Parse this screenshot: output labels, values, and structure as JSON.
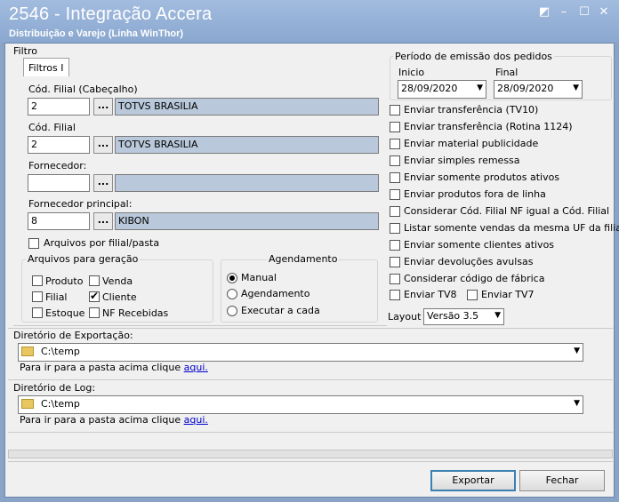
{
  "window": {
    "title": "2546 - Integração Accera",
    "subtitle": "Distribuição e Varejo (Linha WinThor)",
    "buttons": {
      "restore": "◩",
      "minimize": "–",
      "maximize": "☐",
      "close": "✕"
    }
  },
  "filtro": {
    "group_label": "Filtro",
    "tab": "Filtros I",
    "cod_filial_cab": {
      "label": "Cód. Filial (Cabeçalho)",
      "code": "2",
      "name": "TOTVS BRASILIA"
    },
    "cod_filial": {
      "label": "Cód. Filial",
      "code": "2",
      "name": "TOTVS BRASILIA"
    },
    "fornecedor": {
      "label": "Fornecedor:",
      "code": "",
      "name": ""
    },
    "fornecedor_principal": {
      "label": "Fornecedor principal:",
      "code": "8",
      "name": "KIBON"
    },
    "ellipsis": "...",
    "arquivos_por_filial": "Arquivos por filial/pasta"
  },
  "arquivos_geracao": {
    "label": "Arquivos para geração",
    "items": [
      {
        "label": "Produto",
        "checked": false
      },
      {
        "label": "Venda",
        "checked": false
      },
      {
        "label": "Filial",
        "checked": false
      },
      {
        "label": "Cliente",
        "checked": true
      },
      {
        "label": "Estoque",
        "checked": false
      },
      {
        "label": "NF Recebidas",
        "checked": false
      }
    ]
  },
  "agendamento": {
    "label": "Agendamento",
    "options": [
      {
        "label": "Manual",
        "selected": true
      },
      {
        "label": "Agendamento",
        "selected": false
      },
      {
        "label": "Executar a cada",
        "selected": false
      }
    ]
  },
  "periodo": {
    "label": "Período de emissão dos pedidos",
    "inicio_label": "Inicio",
    "inicio": "28/09/2020",
    "final_label": "Final",
    "final": "28/09/2020"
  },
  "options": [
    "Enviar transferência (TV10)",
    "Enviar transferência (Rotina 1124)",
    "Enviar material publicidade",
    "Enviar simples remessa",
    "Enviar somente produtos ativos",
    "Enviar produtos fora de linha",
    "Considerar Cód. Filial NF igual a Cód. Filial",
    "Listar somente vendas da mesma UF da filial",
    "Enviar somente clientes ativos",
    "Enviar devoluções avulsas",
    "Considerar código de fábrica"
  ],
  "tv8": "Enviar TV8",
  "tv7": "Enviar TV7",
  "layout": {
    "label": "Layout",
    "value": "Versão 3.5"
  },
  "dir_export": {
    "label": "Diretório de Exportação:",
    "path": "C:\\temp",
    "hint": "Para ir para a pasta acima clique",
    "link": "aqui."
  },
  "dir_log": {
    "label": "Diretório de Log:",
    "path": "C:\\temp",
    "hint": "Para ir para a pasta acima clique",
    "link": "aqui."
  },
  "actions": {
    "export": "Exportar",
    "close": "Fechar"
  }
}
